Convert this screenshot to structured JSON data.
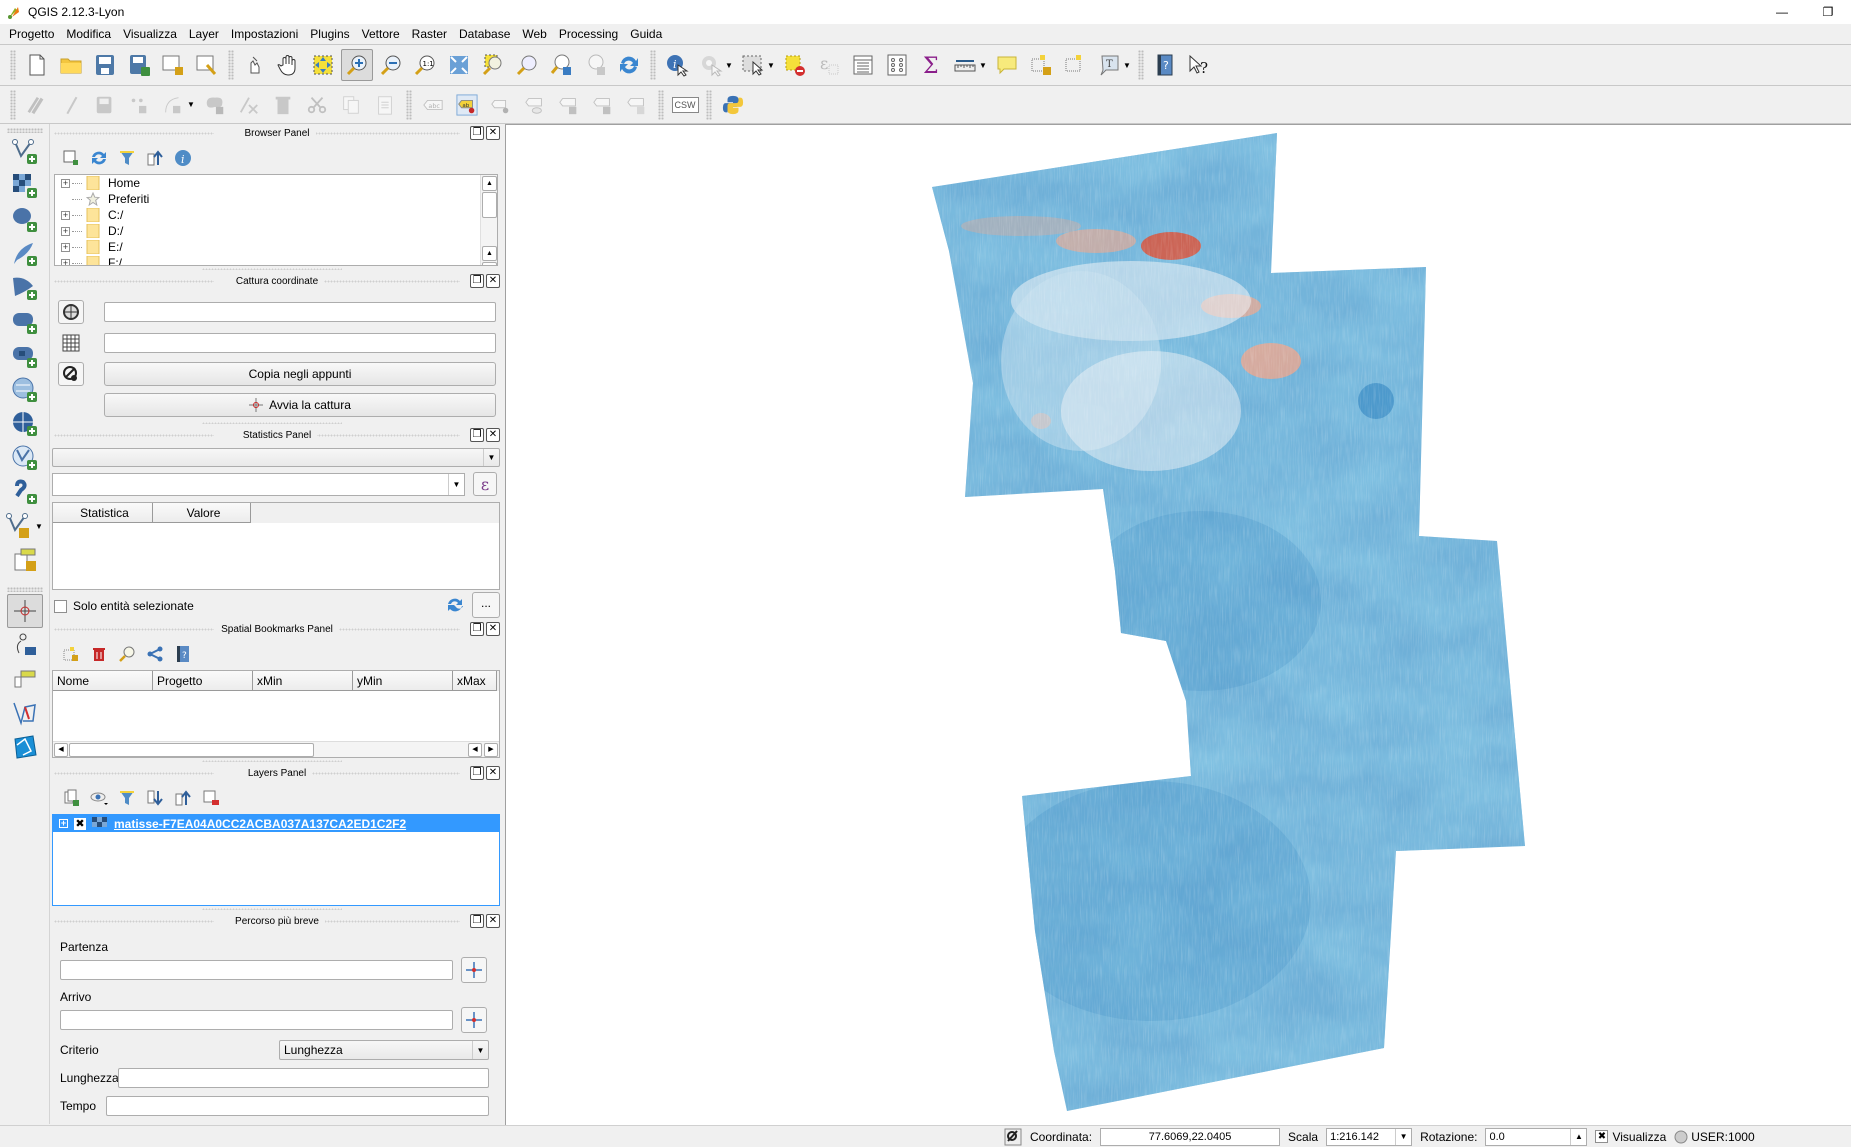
{
  "window": {
    "title": "QGIS 2.12.3-Lyon",
    "minimize_glyph": "—",
    "restore_glyph": "❐"
  },
  "menubar": {
    "items": [
      "Progetto",
      "Modifica",
      "Visualizza",
      "Layer",
      "Impostazioni",
      "Plugins",
      "Vettore",
      "Raster",
      "Database",
      "Web",
      "Processing",
      "Guida"
    ]
  },
  "toolbar1": {
    "groups": [
      [
        "new-project-icon",
        "open-project-icon",
        "save-project-icon",
        "save-as-icon",
        "new-print-composer-icon",
        "composer-manager-icon"
      ],
      [
        "touch-zoom-pan-icon",
        "pan-map-icon",
        "pan-to-selection-icon",
        "zoom-in-icon",
        "zoom-out-icon",
        "zoom-native-icon",
        "zoom-full-icon",
        "zoom-to-selection-icon",
        "zoom-to-layer-icon",
        "zoom-last-icon",
        "zoom-next-icon",
        "refresh-icon"
      ],
      [
        "identify-icon",
        "run-action-icon",
        "select-features-icon",
        "deselect-all-icon",
        "select-by-expression-icon",
        "open-attribute-table-icon",
        "field-calculator-icon",
        "statistical-summary-icon",
        "measure-line-icon",
        "map-tips-icon",
        "new-bookmark-icon",
        "show-bookmarks-icon",
        "text-annotation-icon"
      ],
      [
        "help-contents-icon",
        "whats-this-icon"
      ]
    ],
    "active": "zoom-in-icon"
  },
  "toolbar2": {
    "digitizing": [
      "current-edits-icon",
      "toggle-editing-icon",
      "save-layer-edits-icon",
      "add-feature-icon",
      "node-tool-icon",
      "move-feature-icon",
      "node-tool-2-icon",
      "delete-selected-icon",
      "cut-features-icon",
      "copy-features-icon",
      "paste-features-icon"
    ],
    "labels": [
      "layer-labeling-icon",
      "pin-labels-icon",
      "show-hide-labels-icon",
      "show-hide-labels-eye-icon",
      "move-label-icon",
      "rotate-label-icon",
      "change-label-icon"
    ],
    "csw_label": "CSW",
    "python": "python-console-icon"
  },
  "vtoolbar": {
    "items": [
      "add-vector-layer-icon",
      "add-raster-layer-icon",
      "add-postgis-layer-icon",
      "add-spatialite-layer-icon",
      "add-mssql-layer-icon",
      "add-oracle-layer-icon",
      "add-db2-layer-icon",
      "add-wms-layer-icon",
      "add-wcs-layer-icon",
      "add-wfs-layer-icon",
      "add-delimited-text-icon",
      "new-shapefile-icon",
      "add-virtual-layer-icon"
    ],
    "items2": [
      "coordinate-capture-icon",
      "georeferencer-icon",
      "virtual-field-icon",
      "topology-checker-icon",
      "road-graph-icon"
    ]
  },
  "browser_panel": {
    "title": "Browser Panel",
    "tree": [
      {
        "label": "Home",
        "icon": "folder",
        "expandable": true
      },
      {
        "label": "Preferiti",
        "icon": "star",
        "expandable": false
      },
      {
        "label": "C:/",
        "icon": "folder",
        "expandable": true
      },
      {
        "label": "D:/",
        "icon": "folder",
        "expandable": true
      },
      {
        "label": "E:/",
        "icon": "folder",
        "expandable": true
      },
      {
        "label": "F:/",
        "icon": "folder",
        "expandable": true
      }
    ]
  },
  "coord_capture": {
    "title": "Cattura coordinate",
    "field1_value": "",
    "field2_value": "",
    "copy_label": "Copia negli appunti",
    "start_label": "Avvia la cattura"
  },
  "stats_panel": {
    "title": "Statistics Panel",
    "layer_value": "",
    "field_value": "",
    "expression_label": "ε",
    "columns": [
      "Statistica",
      "Valore"
    ],
    "selected_only_label": "Solo entità selezionate",
    "more_label": "..."
  },
  "bookmarks_panel": {
    "title": "Spatial Bookmarks Panel",
    "columns": [
      "Nome",
      "Progetto",
      "xMin",
      "yMin",
      "xMax"
    ]
  },
  "layers_panel": {
    "title": "Layers Panel",
    "layers": [
      {
        "name": "matisse-F7EA04A0CC2ACBA037A137CA2ED1C2F2",
        "visible": true,
        "selected": true,
        "type": "raster"
      }
    ]
  },
  "shortest_path": {
    "title": "Percorso più breve",
    "start_label": "Partenza",
    "start_value": "",
    "end_label": "Arrivo",
    "end_value": "",
    "criterion_label": "Criterio",
    "criterion_value": "Lunghezza",
    "length_label": "Lunghezza",
    "length_value": "",
    "time_label": "Tempo",
    "time_value": ""
  },
  "map": {
    "layer_colormap": "RdBu (blue dominant)",
    "colors": {
      "deep_blue": "#3a8cc4",
      "mid_blue": "#7db6db",
      "light_blue": "#c9e1ef",
      "pale": "#eef2f5",
      "salmon": "#f4a68a",
      "red": "#d9553d"
    }
  },
  "statusbar": {
    "coord_label": "Coordinata:",
    "coord_value": "77.6069,22.0405",
    "scale_label": "Scala",
    "scale_value": "1:216.142",
    "rotation_label": "Rotazione:",
    "rotation_value": "0.0",
    "render_label": "Visualizza",
    "render_checked": true,
    "crs_label": "USER:1000"
  }
}
